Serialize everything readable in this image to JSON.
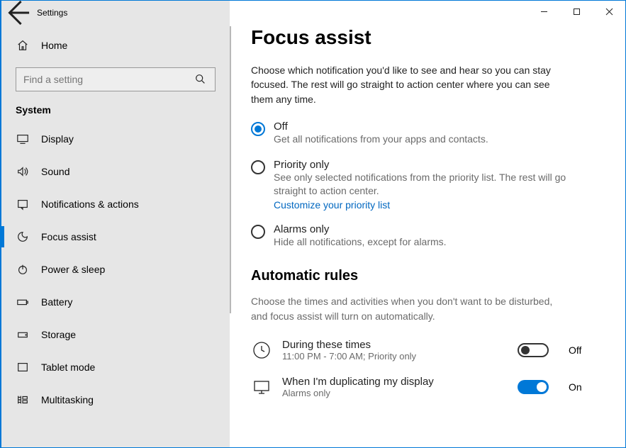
{
  "window": {
    "title": "Settings"
  },
  "sidebar": {
    "home": "Home",
    "search_placeholder": "Find a setting",
    "category": "System",
    "items": [
      {
        "label": "Display"
      },
      {
        "label": "Sound"
      },
      {
        "label": "Notifications & actions"
      },
      {
        "label": "Focus assist"
      },
      {
        "label": "Power & sleep"
      },
      {
        "label": "Battery"
      },
      {
        "label": "Storage"
      },
      {
        "label": "Tablet mode"
      },
      {
        "label": "Multitasking"
      }
    ]
  },
  "page": {
    "heading": "Focus assist",
    "description": "Choose which notification you'd like to see and hear so you can stay focused. The rest will go straight to action center where you can see them any time.",
    "options": [
      {
        "label": "Off",
        "sub": "Get all notifications from your apps and contacts.",
        "selected": true
      },
      {
        "label": "Priority only",
        "sub": "See only selected notifications from the priority list. The rest will go straight to action center.",
        "link": "Customize your priority list",
        "selected": false
      },
      {
        "label": "Alarms only",
        "sub": "Hide all notifications, except for alarms.",
        "selected": false
      }
    ],
    "rules_heading": "Automatic rules",
    "rules_desc": "Choose the times and activities when you don't want to be disturbed, and focus assist will turn on automatically.",
    "rules": [
      {
        "title": "During these times",
        "status": "11:00 PM - 7:00 AM; Priority only",
        "on": false,
        "state_label": "Off"
      },
      {
        "title": "When I'm duplicating my display",
        "status": "Alarms only",
        "on": true,
        "state_label": "On"
      }
    ]
  }
}
